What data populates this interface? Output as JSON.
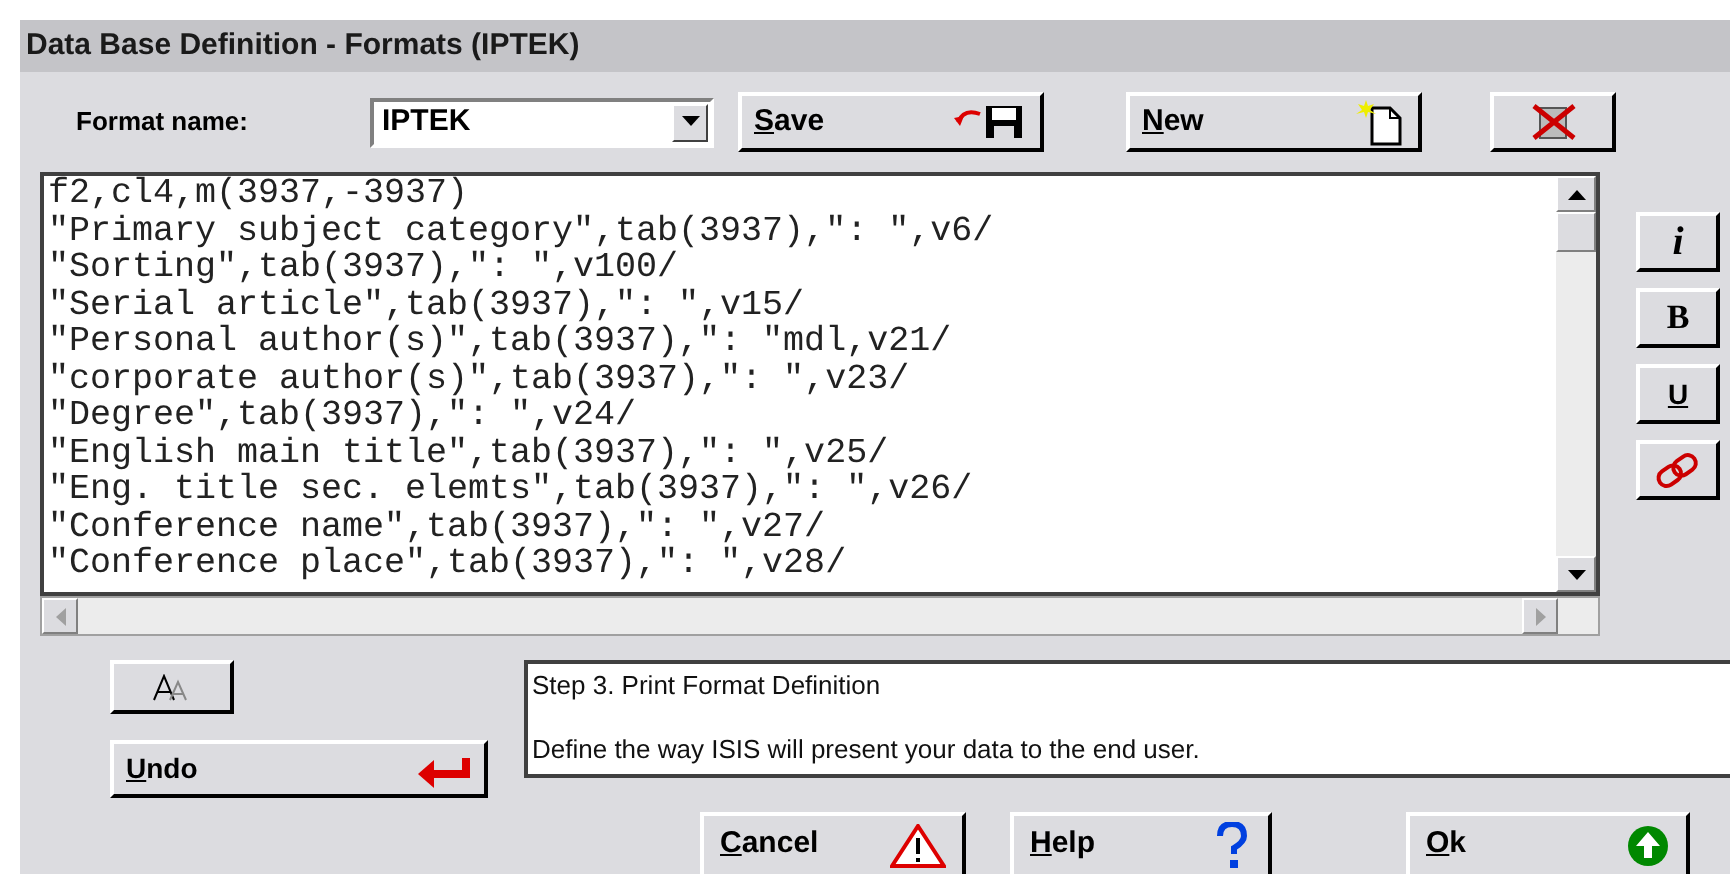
{
  "window": {
    "title": "Data Base Definition - Formats (IPTEK)"
  },
  "format_name": {
    "label": "Format name:",
    "value": "IPTEK"
  },
  "toolbar_buttons": [
    {
      "kind": "save",
      "label": "Save",
      "first_letter_underlined": true
    },
    {
      "kind": "new",
      "label": "New",
      "first_letter_underlined": true
    },
    {
      "kind": "delete"
    }
  ],
  "editor": {
    "lines": [
      "f2,cl4,m(3937,-3937)",
      "\"Primary subject category\",tab(3937),\": \",v6/",
      "\"Sorting\",tab(3937),\": \",v100/",
      "\"Serial article\",tab(3937),\": \",v15/",
      "\"Personal author(s)\",tab(3937),\": \"mdl,v21/",
      "\"corporate author(s)\",tab(3937),\": \",v23/",
      "\"Degree\",tab(3937),\": \",v24/",
      "\"English main title\",tab(3937),\": \",v25/",
      "\"Eng. title sec. elemts\",tab(3937),\": \",v26/",
      "\"Conference name\",tab(3937),\": \",v27/",
      "\"Conference place\",tab(3937),\": \",v28/"
    ]
  },
  "style_buttons": [
    {
      "kind": "italic",
      "label": "i"
    },
    {
      "kind": "bold",
      "label": "B"
    },
    {
      "kind": "underline",
      "label": "U"
    },
    {
      "kind": "link"
    }
  ],
  "font_button": {
    "kind": "font"
  },
  "undo_button": {
    "label": "Undo",
    "first_letter_underlined": true
  },
  "message": {
    "title": "Step 3. Print Format Definition",
    "text": "Define the way ISIS will present your data to the end user."
  },
  "bottom_buttons": [
    {
      "kind": "cancel",
      "label": "Cancel",
      "first_letter_underlined": true
    },
    {
      "kind": "help",
      "label": "Help",
      "first_letter_underlined": true
    },
    {
      "kind": "ok",
      "label": "Ok",
      "first_letter_underlined": true
    }
  ]
}
